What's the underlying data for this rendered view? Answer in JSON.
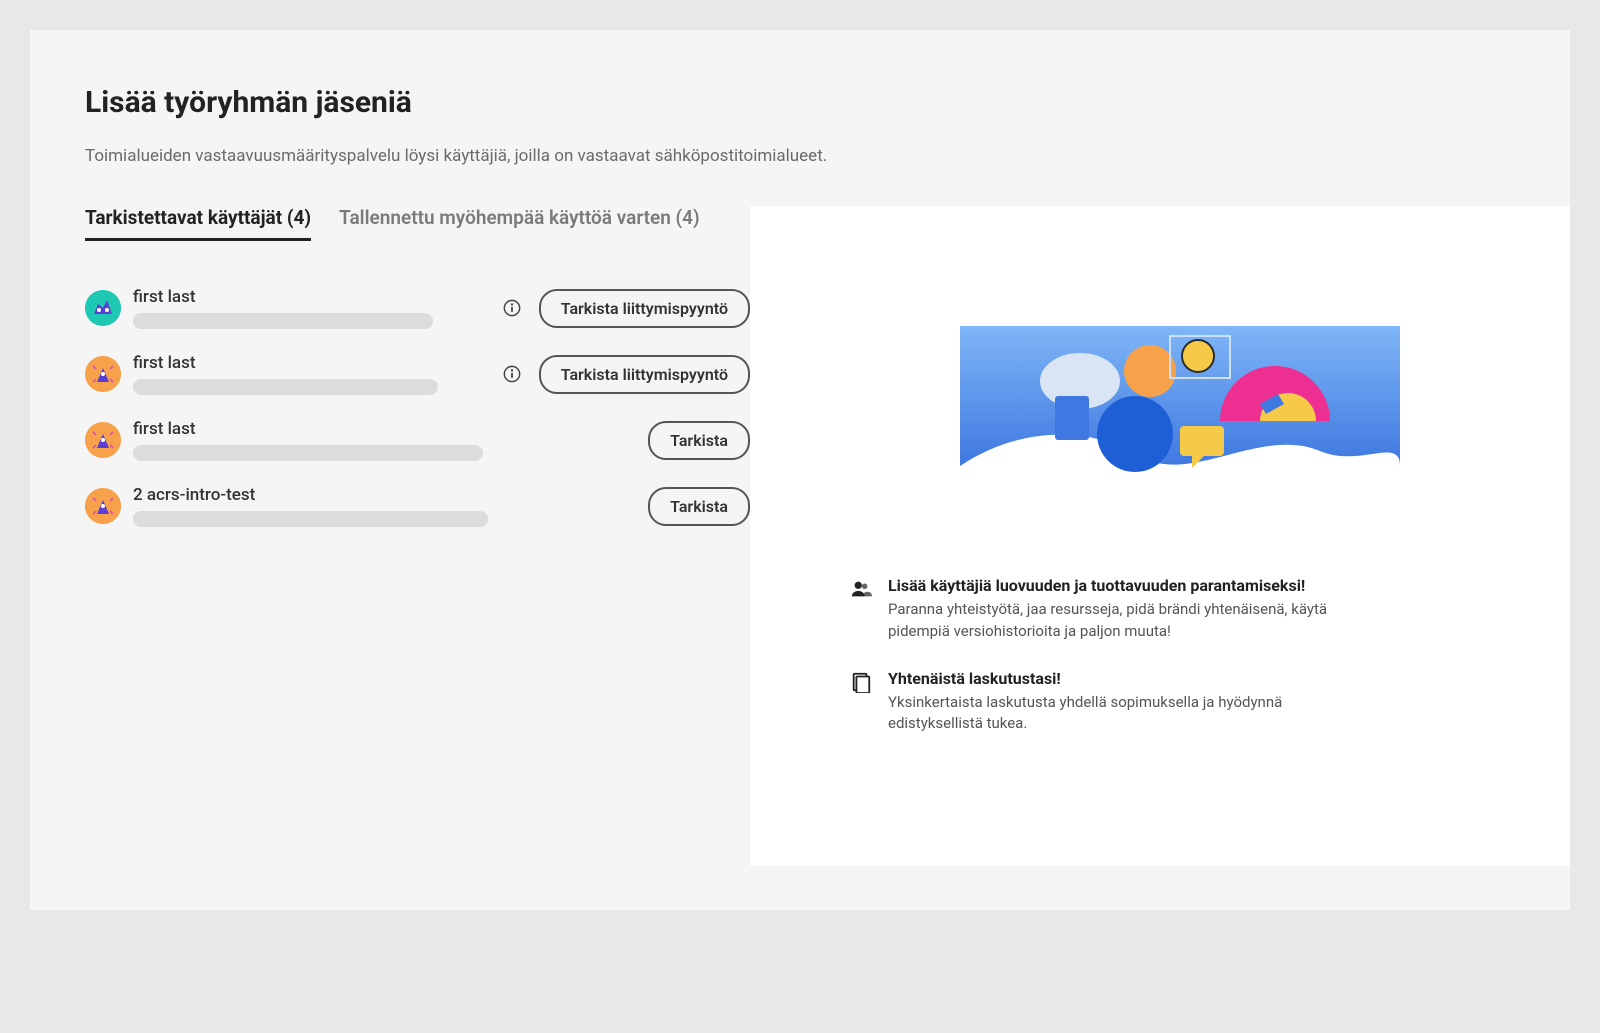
{
  "header": {
    "title": "Lisää työryhmän jäseniä",
    "subtitle": "Toimialueiden vastaavuusmäärityspalvelu löysi käyttäjiä, joilla on vastaavat sähköpostitoimialueet."
  },
  "tabs": {
    "review": {
      "label": "Tarkistettavat käyttäjät (4)",
      "active": true
    },
    "saved": {
      "label": "Tallennettu myöhempää käyttöä varten (4)",
      "active": false
    }
  },
  "actions": {
    "review_request": "Tarkista liittymispyyntö",
    "review": "Tarkista"
  },
  "users": [
    {
      "name": "first last",
      "avatar": "teal",
      "has_info": true,
      "action": "review_request",
      "redact": "redact-w1"
    },
    {
      "name": "first last",
      "avatar": "orange",
      "has_info": true,
      "action": "review_request",
      "redact": "redact-w2"
    },
    {
      "name": "first last",
      "avatar": "orange",
      "has_info": false,
      "action": "review",
      "redact": "redact-w3"
    },
    {
      "name": "2 acrs-intro-test",
      "avatar": "orange",
      "has_info": false,
      "action": "review",
      "redact": "redact-w4"
    }
  ],
  "promo": {
    "features": [
      {
        "icon": "users-icon",
        "title": "Lisää käyttäjiä luovuuden ja tuottavuuden parantamiseksi!",
        "body": "Paranna yhteistyötä, jaa resursseja, pidä brändi yhtenäisenä, käytä pidempiä versiohistorioita ja paljon muuta!"
      },
      {
        "icon": "document-icon",
        "title": "Yhtenäistä laskutustasi!",
        "body": "Yksinkertaista laskutusta yhdellä sopimuksella ja hyödynnä edistyksellistä tukea."
      }
    ]
  }
}
